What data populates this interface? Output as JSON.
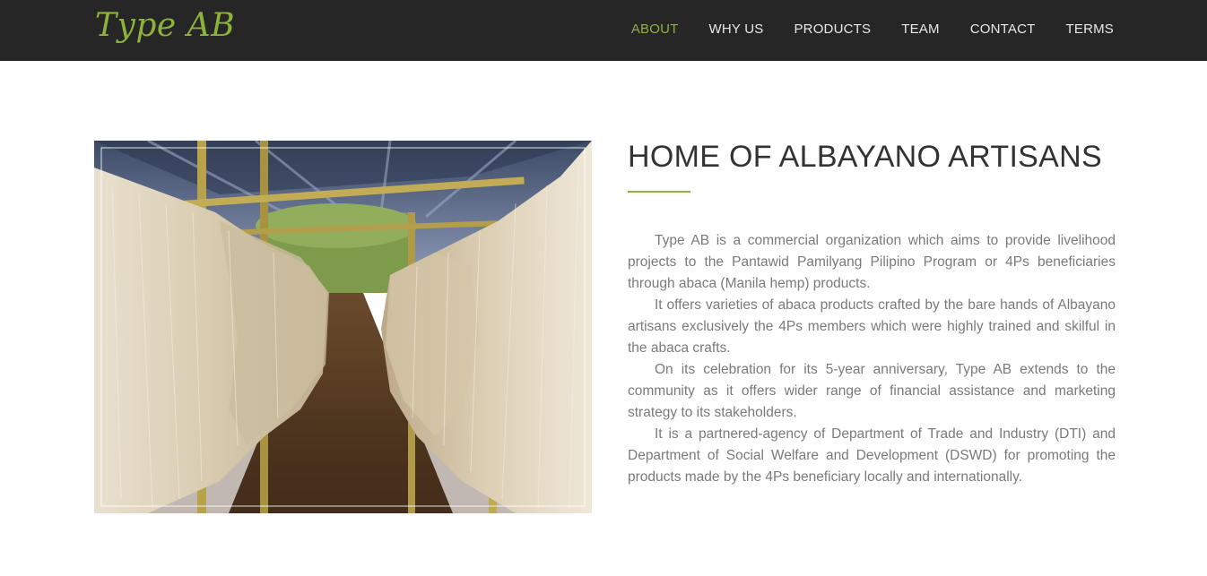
{
  "brand": {
    "logo": "Type AB",
    "accent_color": "#8db33a",
    "navbar_color": "#262626"
  },
  "nav": {
    "items": [
      {
        "label": "ABOUT",
        "active": true
      },
      {
        "label": "WHY US",
        "active": false
      },
      {
        "label": "PRODUCTS",
        "active": false
      },
      {
        "label": "TEAM",
        "active": false
      },
      {
        "label": "CONTACT",
        "active": false
      },
      {
        "label": "TERMS",
        "active": false
      }
    ]
  },
  "about": {
    "image": {
      "icon": "abaca-fiber-drying-photo"
    },
    "title": "HOME OF ALBAYANO ARTISANS",
    "paragraphs": [
      "Type AB is a commercial organization which aims to provide livelihood projects to the Pantawid Pamilyang Pilipino Program or 4Ps beneficiaries through abaca (Manila hemp) products.",
      "It offers varieties of abaca products crafted by the bare hands of Albayano artisans exclusively the 4Ps members which were highly trained and skilful in the abaca crafts.",
      "On its celebration for its 5-year anniversary, Type AB extends to the community as it offers wider range of financial assistance and marketing strategy to its stakeholders.",
      "It is a partnered-agency of Department of Trade and Industry (DTI) and Department of Social Welfare and Development (DSWD) for promoting the products made by the 4Ps beneficiary locally and internationally."
    ]
  }
}
